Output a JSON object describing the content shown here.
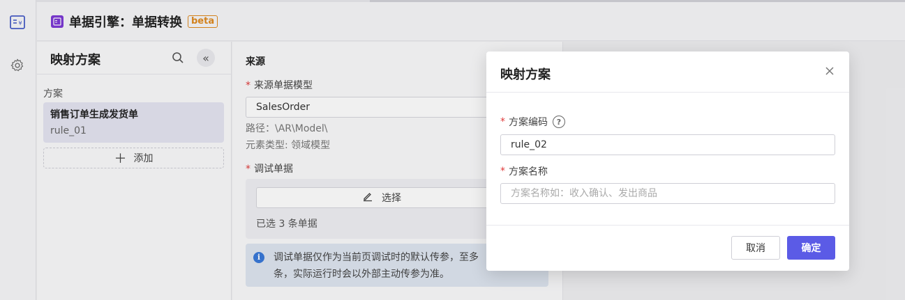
{
  "header": {
    "title": "单据引擎：单据转换",
    "badge": "beta"
  },
  "left_panel": {
    "title": "映射方案",
    "section_label": "方案",
    "selected_item": {
      "title": "销售订单生成发货单",
      "code": "rule_01"
    },
    "add_label": "添加"
  },
  "form": {
    "section_title": "来源",
    "source_model_label": "来源单据模型",
    "source_model_value": "SalesOrder",
    "path_text": "路径：\\AR\\Model\\",
    "type_text": "元素类型: 领域模型",
    "debug_label": "调试单据",
    "select_label": "选择",
    "selected_count_text": "已选 3 条单据",
    "info_text": "调试单据仅作为当前页调试时的默认传参，至多",
    "info_text_2": "条，实际运行时会以外部主动传参为准。"
  },
  "modal": {
    "title": "映射方案",
    "code_label": "方案编码",
    "code_value": "rule_02",
    "name_label": "方案名称",
    "name_placeholder": "方案名称如：收入确认、发出商品",
    "cancel_label": "取消",
    "ok_label": "确定"
  },
  "colors": {
    "primary": "#5b5be6",
    "required": "#e03a3a",
    "badge": "#e08a1e",
    "logo": "#7d3ad6",
    "info": "#3a7ad9"
  }
}
